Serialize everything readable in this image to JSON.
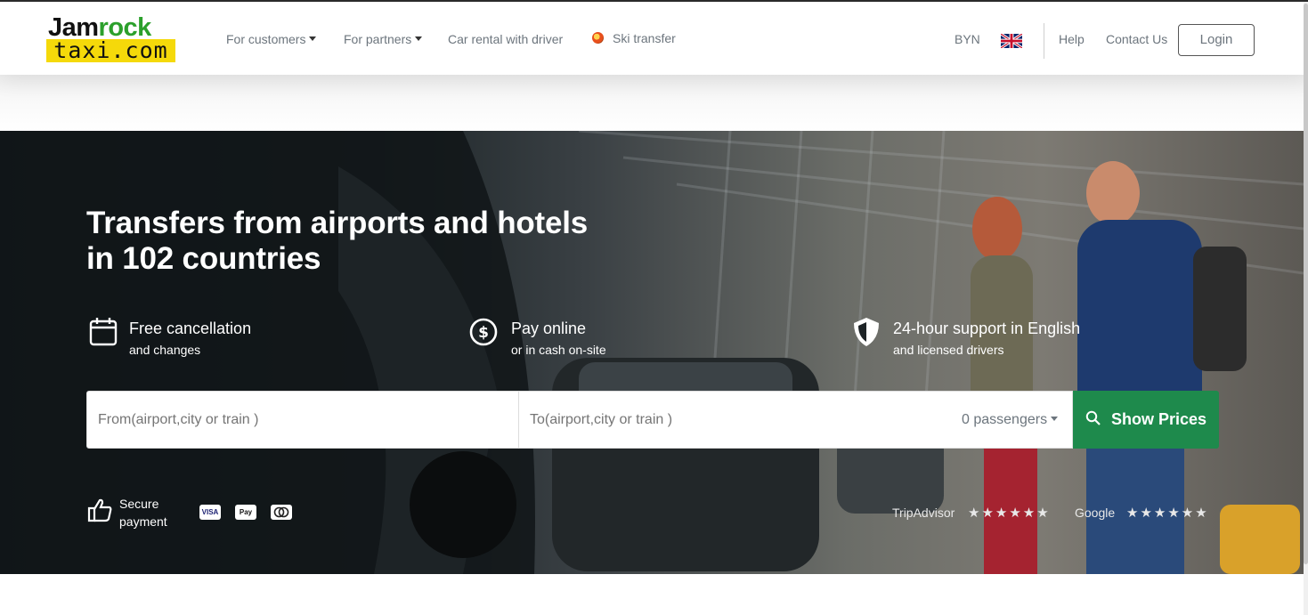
{
  "header": {
    "logo": {
      "line1_a": "Jam",
      "line1_b": "rock",
      "line2": "taxi.com"
    },
    "nav": [
      {
        "label": "For customers",
        "dropdown": true
      },
      {
        "label": "For partners",
        "dropdown": true
      },
      {
        "label": "Car rental with driver",
        "dropdown": false
      },
      {
        "label": "Ski transfer",
        "dropdown": false,
        "icon": "ski-icon"
      }
    ],
    "currency": "BYN",
    "language_flag": "uk-flag-icon",
    "help": "Help",
    "contact": "Contact Us",
    "login": "Login"
  },
  "hero": {
    "title_line1": "Transfers from airports and hotels",
    "title_line2": "in 102 countries",
    "features": [
      {
        "icon": "calendar-icon",
        "title": "Free cancellation",
        "subtitle": "and changes"
      },
      {
        "icon": "dollar-coin-icon",
        "title": "Pay online",
        "subtitle": "or in cash on-site"
      },
      {
        "icon": "shield-icon",
        "title": "24-hour support in English",
        "subtitle": "and licensed drivers"
      }
    ],
    "search": {
      "from_placeholder": "From(airport,city or train )",
      "to_placeholder": "To(airport,city or train )",
      "passengers": "0 passengers",
      "button": "Show Prices"
    },
    "secure_payment": {
      "line1": "Secure",
      "line2": "payment"
    },
    "payment_methods": [
      "VISA",
      "Pay",
      "MC"
    ],
    "ratings": [
      {
        "source": "TripAdvisor",
        "stars": "★★★★★★"
      },
      {
        "source": "Google",
        "stars": "★★★★★★"
      }
    ]
  },
  "colors": {
    "brand_green": "#1e8a4c",
    "logo_yellow": "#f5d90a",
    "logo_green": "#2ca02c"
  }
}
